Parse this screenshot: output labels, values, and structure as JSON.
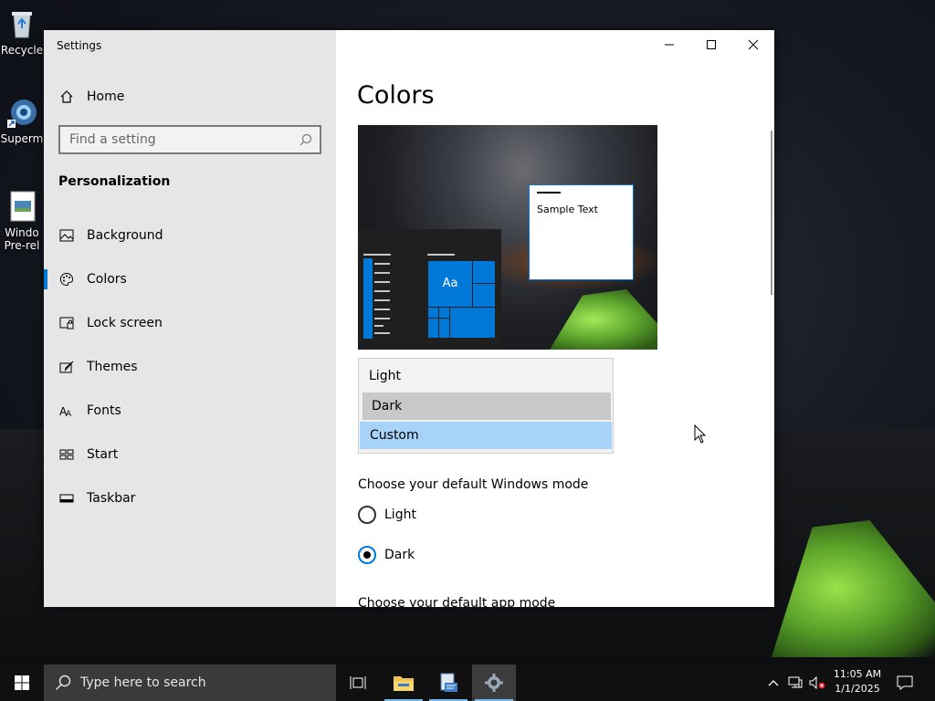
{
  "desktop": {
    "icons": [
      {
        "label": "Recycle",
        "icon": "recycle-bin-icon"
      },
      {
        "label": "Superm",
        "icon": "supermium-icon"
      },
      {
        "label": "Windo",
        "label2": "Pre-rel",
        "icon": "document-icon"
      }
    ]
  },
  "window": {
    "title": "Settings",
    "controls": {
      "minimize": "minimize-icon",
      "maximize": "maximize-icon",
      "close": "close-icon"
    }
  },
  "sidebar": {
    "home": "Home",
    "search_placeholder": "Find a setting",
    "section": "Personalization",
    "items": [
      {
        "label": "Background",
        "icon": "image-icon"
      },
      {
        "label": "Colors",
        "icon": "palette-icon",
        "selected": true
      },
      {
        "label": "Lock screen",
        "icon": "lock-screen-icon"
      },
      {
        "label": "Themes",
        "icon": "themes-icon"
      },
      {
        "label": "Fonts",
        "icon": "fonts-icon"
      },
      {
        "label": "Start",
        "icon": "start-icon"
      },
      {
        "label": "Taskbar",
        "icon": "taskbar-icon"
      }
    ]
  },
  "main": {
    "title": "Colors",
    "preview": {
      "sample_text": "Sample Text",
      "tile_text": "Aa"
    },
    "color_dropdown": {
      "options": [
        "Light",
        "Dark",
        "Custom"
      ],
      "selected": "Custom"
    },
    "windows_mode": {
      "label": "Choose your default Windows mode",
      "options": [
        "Light",
        "Dark"
      ],
      "selected": "Dark"
    },
    "app_mode_label": "Choose your default app mode"
  },
  "taskbar": {
    "search_placeholder": "Type here to search",
    "time": "11:05 AM",
    "date": "1/1/2025"
  },
  "colors": {
    "accent": "#0078d7",
    "sidebar_bg": "#e6e6e6",
    "taskbar_bg": "#101010",
    "custom_highlight": "#a6d3f7"
  }
}
